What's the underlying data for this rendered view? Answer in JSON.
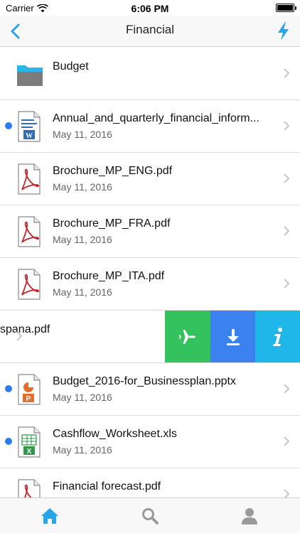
{
  "status_bar": {
    "carrier": "Carrier",
    "time": "6:06 PM",
    "wifi_icon": "wifi-icon",
    "battery_icon": "battery-icon"
  },
  "nav": {
    "title": "Financial",
    "back_icon": "chevron-left-icon",
    "action_icon": "lightning-bolt-icon",
    "accent_color": "#2aa6e8"
  },
  "items": [
    {
      "name": "Budget",
      "date": "",
      "type": "folder",
      "unread": false
    },
    {
      "name": "Annual_and_quarterly_financial_inform...",
      "date": "May 11, 2016",
      "type": "word",
      "unread": true
    },
    {
      "name": "Brochure_MP_ENG.pdf",
      "date": "May 11, 2016",
      "type": "pdf",
      "unread": false
    },
    {
      "name": "Brochure_MP_FRA.pdf",
      "date": "May 11, 2016",
      "type": "pdf",
      "unread": false
    },
    {
      "name": "Brochure_MP_ITA.pdf",
      "date": "May 11, 2016",
      "type": "pdf",
      "unread": false
    },
    {
      "name": "spana.pdf",
      "date": "",
      "type": "pdf",
      "unread": false,
      "swiped": true
    },
    {
      "name": "Budget_2016-for_Businessplan.pptx",
      "date": "May 11, 2016",
      "type": "powerpoint",
      "unread": true
    },
    {
      "name": "Cashflow_Worksheet.xls",
      "date": "May 11, 2016",
      "type": "excel",
      "unread": true
    },
    {
      "name": "Financial forecast.pdf",
      "date": "",
      "type": "pdf",
      "unread": false
    }
  ],
  "swipe_actions": [
    {
      "icon": "airplane-icon",
      "color": "#34c25e"
    },
    {
      "icon": "download-icon",
      "color": "#3b82f0"
    },
    {
      "icon": "info-icon",
      "color": "#1fb6ea"
    }
  ],
  "tab_bar": {
    "tabs": [
      {
        "icon": "home-icon",
        "active": true
      },
      {
        "icon": "search-icon",
        "active": false
      },
      {
        "icon": "profile-icon",
        "active": false
      }
    ]
  }
}
